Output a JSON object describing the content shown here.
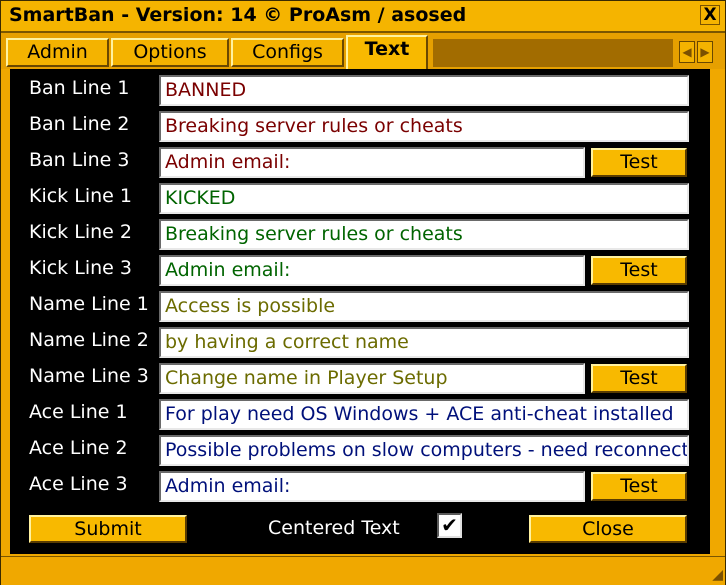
{
  "window": {
    "title": "SmartBan - Version: 14  © ProAsm / asosed",
    "close_glyph": "X"
  },
  "tabs": [
    {
      "label": "Admin",
      "active": false
    },
    {
      "label": "Options",
      "active": false
    },
    {
      "label": "Configs",
      "active": false
    },
    {
      "label": "Text",
      "active": true
    }
  ],
  "tab_scroll": {
    "left_glyph": "◀",
    "right_glyph": "▶"
  },
  "rows": [
    {
      "label": "Ban Line 1",
      "value": "BANNED",
      "group": "ban",
      "has_test": false
    },
    {
      "label": "Ban Line 2",
      "value": "Breaking server rules or cheats",
      "group": "ban",
      "has_test": false
    },
    {
      "label": "Ban Line 3",
      "value": "Admin email:",
      "group": "ban",
      "has_test": true
    },
    {
      "label": "Kick Line 1",
      "value": "KICKED",
      "group": "kick",
      "has_test": false
    },
    {
      "label": "Kick Line 2",
      "value": "Breaking server rules or cheats",
      "group": "kick",
      "has_test": false
    },
    {
      "label": "Kick Line 3",
      "value": "Admin email:",
      "group": "kick",
      "has_test": true
    },
    {
      "label": "Name Line 1",
      "value": "Access is possible",
      "group": "name",
      "has_test": false
    },
    {
      "label": "Name Line 2",
      "value": "by having a correct name",
      "group": "name",
      "has_test": false
    },
    {
      "label": "Name Line 3",
      "value": "Change name in Player Setup",
      "group": "name",
      "has_test": true
    },
    {
      "label": "Ace Line 1",
      "value": "For play need OS Windows + ACE anti-cheat installed",
      "group": "ace",
      "has_test": false
    },
    {
      "label": "Ace Line 2",
      "value": "Possible problems on slow computers - need reconnect",
      "group": "ace",
      "has_test": false
    },
    {
      "label": "Ace Line 3",
      "value": "Admin email:",
      "group": "ace",
      "has_test": true
    }
  ],
  "test_label": "Test",
  "colors": {
    "accent": "#f8b900",
    "ban": "#7a0000",
    "kick": "#006400",
    "name": "#6b6b00",
    "ace": "#00107a"
  },
  "footer": {
    "submit_label": "Submit",
    "centered_text_label": "Centered Text",
    "centered_text_checked": true,
    "check_glyph": "✔",
    "close_label": "Close"
  },
  "statusbar": {
    "grip_glyph": "◢"
  }
}
